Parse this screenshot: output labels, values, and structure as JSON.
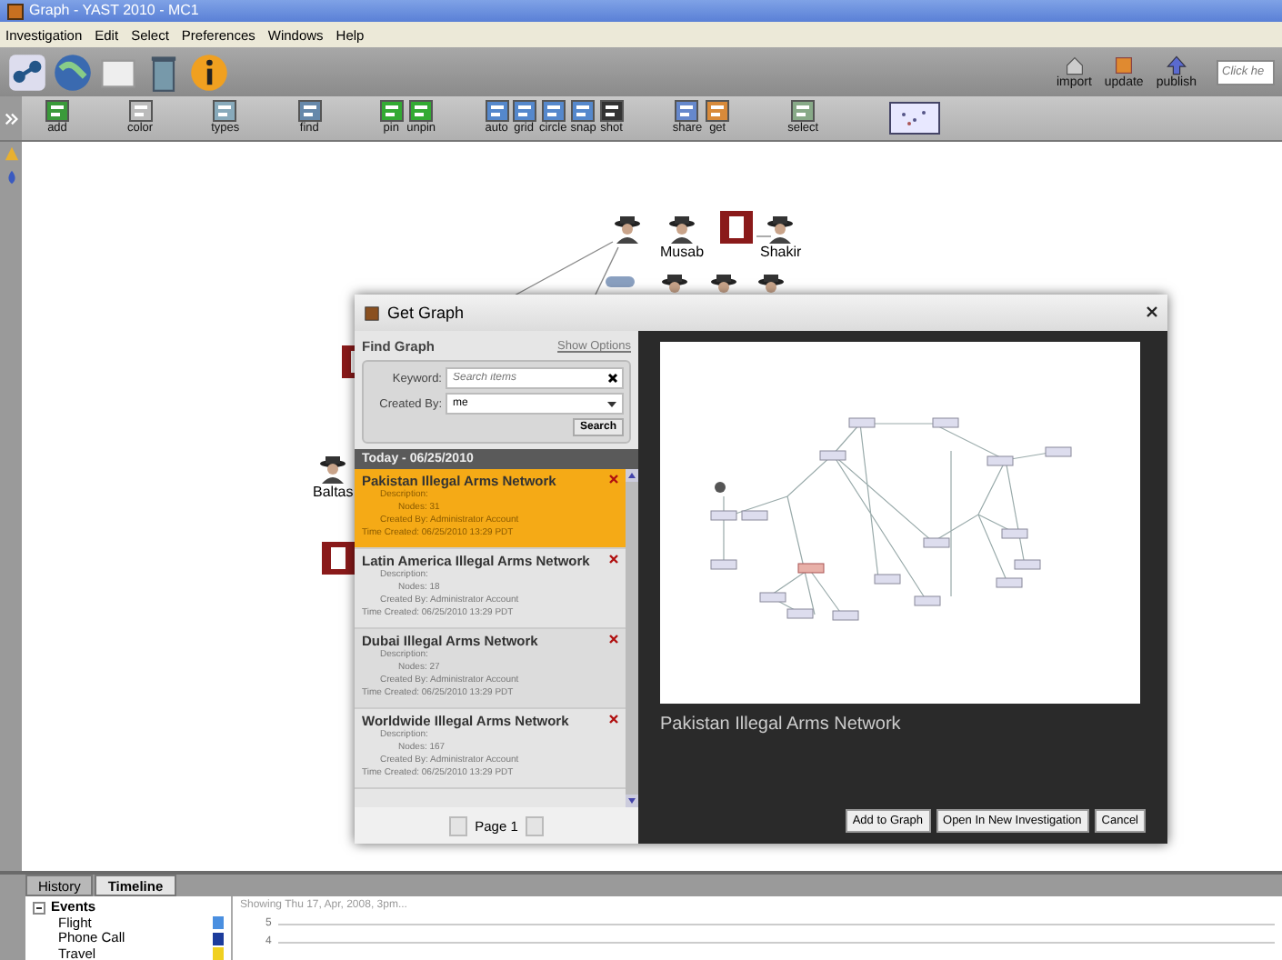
{
  "window": {
    "title": "Graph - YAST 2010 - MC1"
  },
  "menu": [
    "Investigation",
    "Edit",
    "Select",
    "Preferences",
    "Windows",
    "Help"
  ],
  "right_tools": [
    "import",
    "update",
    "publish"
  ],
  "search": {
    "placeholder": "Click he"
  },
  "graph_tools": [
    "add",
    "color",
    "types",
    "find",
    "pin",
    "unpin",
    "auto",
    "grid",
    "circle",
    "snap",
    "shot",
    "share",
    "get",
    "select"
  ],
  "canvas": {
    "nodes": [
      {
        "kind": "person"
      },
      {
        "kind": "person",
        "label": "Musab"
      },
      {
        "kind": "document"
      },
      {
        "kind": "person",
        "label": "Shakir"
      },
      {
        "kind": "device"
      },
      {
        "kind": "person"
      },
      {
        "kind": "person"
      },
      {
        "kind": "person"
      },
      {
        "kind": "document"
      },
      {
        "kind": "person",
        "label": "Baltas"
      },
      {
        "kind": "document"
      }
    ]
  },
  "dialog": {
    "title": "Get Graph",
    "find": {
      "heading": "Find Graph",
      "options_link": "Show Options",
      "keyword_label": "Keyword:",
      "keyword_placeholder": "Search items",
      "created_by_label": "Created By:",
      "created_by_value": "me",
      "search_button": "Search"
    },
    "list_header": "Today - 06/25/2010",
    "graphs": [
      {
        "name": "Pakistan Illegal Arms Network",
        "selected": true,
        "description": "Description:",
        "nodes": "Nodes: 31",
        "created_by": "Created By: Administrator Account",
        "time_created": "Time Created: 06/25/2010 13:29 PDT"
      },
      {
        "name": "Latin America Illegal Arms Network",
        "selected": false,
        "description": "Description:",
        "nodes": "Nodes: 18",
        "created_by": "Created By: Administrator Account",
        "time_created": "Time Created: 06/25/2010 13:29 PDT"
      },
      {
        "name": "Dubai Illegal Arms Network",
        "selected": false,
        "description": "Description:",
        "nodes": "Nodes: 27",
        "created_by": "Created By: Administrator Account",
        "time_created": "Time Created: 06/25/2010 13:29 PDT"
      },
      {
        "name": "Worldwide Illegal Arms Network",
        "selected": false,
        "description": "Description:",
        "nodes": "Nodes: 167",
        "created_by": "Created By: Administrator Account",
        "time_created": "Time Created: 06/25/2010 13:29 PDT"
      }
    ],
    "page": "Page 1",
    "preview_title": "Pakistan Illegal Arms Network",
    "buttons": [
      "Add to Graph",
      "Open In New Investigation",
      "Cancel"
    ]
  },
  "bottom_tabs": [
    {
      "label": "History",
      "selected": false
    },
    {
      "label": "Timeline",
      "selected": true
    }
  ],
  "events": {
    "label": "Events",
    "expanded": true,
    "children": [
      {
        "label": "Flight",
        "color": "#4a8fe0"
      },
      {
        "label": "Phone Call",
        "color": "#1c3c9c"
      },
      {
        "label": "Travel",
        "color": "#f0d020"
      }
    ]
  },
  "timeline": {
    "caption": "Showing Thu 17, Apr, 2008, 3pm...",
    "ticks": [
      "5",
      "4"
    ]
  }
}
